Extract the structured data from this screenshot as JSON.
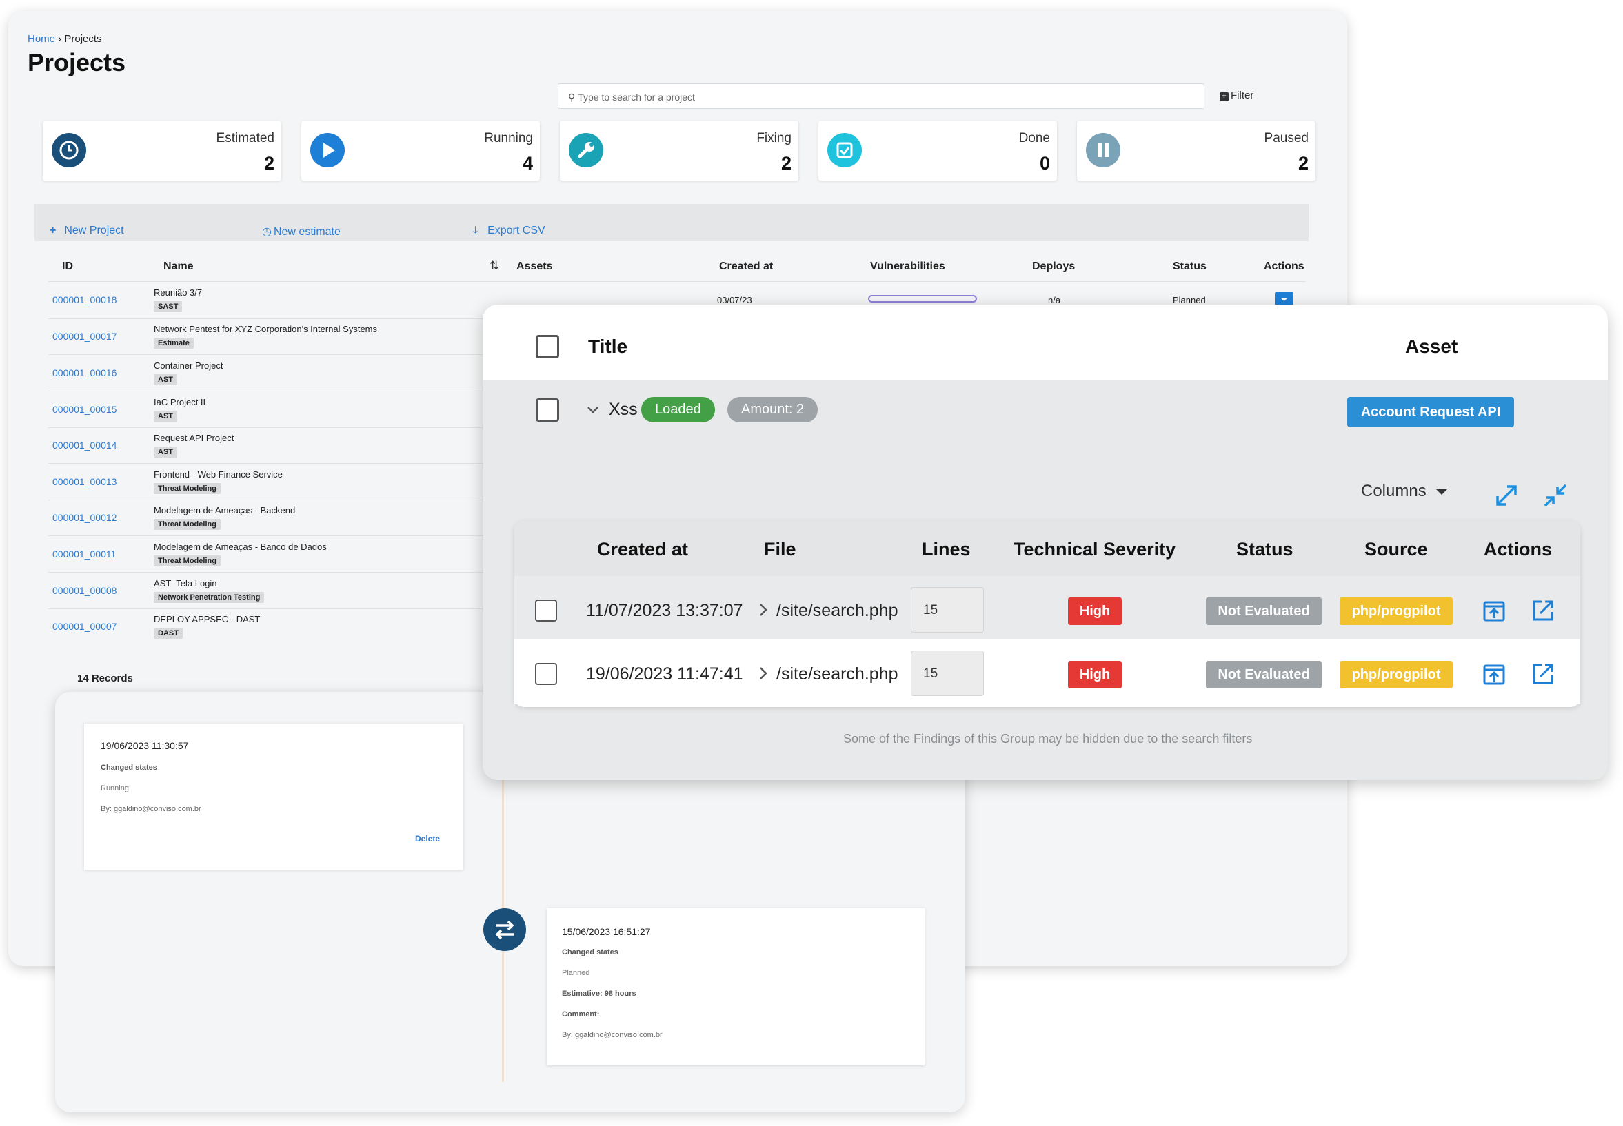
{
  "breadcrumb": {
    "home": "Home",
    "separator": " › ",
    "current": "Projects"
  },
  "page_title": "Projects",
  "search": {
    "placeholder": "Type to search for a project"
  },
  "filter_label": "Filter",
  "stats": [
    {
      "label": "Estimated",
      "value": "2",
      "color": "#1a4f7a",
      "icon": "clock-icon"
    },
    {
      "label": "Running",
      "value": "4",
      "color": "#1e7fd6",
      "icon": "play-icon"
    },
    {
      "label": "Fixing",
      "value": "2",
      "color": "#1aa3b5",
      "icon": "wrench-icon"
    },
    {
      "label": "Done",
      "value": "0",
      "color": "#20c3de",
      "icon": "check-icon"
    },
    {
      "label": "Paused",
      "value": "2",
      "color": "#7ba3b8",
      "icon": "pause-icon"
    }
  ],
  "actions": {
    "new_project": "New Project",
    "new_estimate": "New estimate",
    "export_csv": "Export CSV"
  },
  "projects_table": {
    "headers": {
      "id": "ID",
      "name": "Name",
      "assets": "Assets",
      "created_at": "Created at",
      "vulnerabilities": "Vulnerabilities",
      "deploys": "Deploys",
      "status": "Status",
      "actions": "Actions"
    },
    "first_row_extra": {
      "created_at": "03/07/23",
      "deploys": "n/a",
      "status": "Planned"
    },
    "rows": [
      {
        "id": "000001_00018",
        "name": "Reunião 3/7",
        "tag": "SAST"
      },
      {
        "id": "000001_00017",
        "name": "Network Pentest for XYZ Corporation's Internal Systems",
        "tag": "Estimate"
      },
      {
        "id": "000001_00016",
        "name": "Container Project",
        "tag": "AST"
      },
      {
        "id": "000001_00015",
        "name": "IaC Project II",
        "tag": "AST"
      },
      {
        "id": "000001_00014",
        "name": "Request API Project",
        "tag": "AST"
      },
      {
        "id": "000001_00013",
        "name": "Frontend - Web Finance Service",
        "tag": "Threat Modeling"
      },
      {
        "id": "000001_00012",
        "name": "Modelagem de Ameaças - Backend",
        "tag": "Threat Modeling"
      },
      {
        "id": "000001_00011",
        "name": "Modelagem de Ameaças - Banco de Dados",
        "tag": "Threat Modeling"
      },
      {
        "id": "000001_00008",
        "name": "AST- Tela Login",
        "tag": "Network Penetration Testing"
      },
      {
        "id": "000001_00007",
        "name": "DEPLOY APPSEC - DAST",
        "tag": "DAST"
      }
    ],
    "records": "14 Records"
  },
  "timeline": {
    "entry1": {
      "date": "19/06/2023 11:30:57",
      "title": "Changed states",
      "state": "Running",
      "by": "By: ggaldino@conviso.com.br",
      "delete": "Delete"
    },
    "entry2": {
      "date": "15/06/2023 16:51:27",
      "title": "Changed states",
      "state": "Planned",
      "estimative": "Estimative: 98 hours",
      "comment": "Comment:",
      "by": "By: ggaldino@conviso.com.br"
    }
  },
  "findings": {
    "col_title": "Title",
    "col_asset": "Asset",
    "group": {
      "name": "Xss",
      "loaded": "Loaded",
      "amount": "Amount: 2",
      "asset": "Account Request API"
    },
    "columns_label": "Columns",
    "headers": {
      "created_at": "Created at",
      "file": "File",
      "lines": "Lines",
      "severity": "Technical Severity",
      "status": "Status",
      "source": "Source",
      "actions": "Actions"
    },
    "rows": [
      {
        "created_at": "11/07/2023 13:37:07",
        "file": "/site/search.php",
        "lines": "15",
        "severity": "High",
        "status": "Not Evaluated",
        "source": "php/progpilot"
      },
      {
        "created_at": "19/06/2023 11:47:41",
        "file": "/site/search.php",
        "lines": "15",
        "severity": "High",
        "status": "Not Evaluated",
        "source": "php/progpilot"
      }
    ],
    "footnote": "Some of the Findings of this Group may be hidden due to the search filters"
  }
}
